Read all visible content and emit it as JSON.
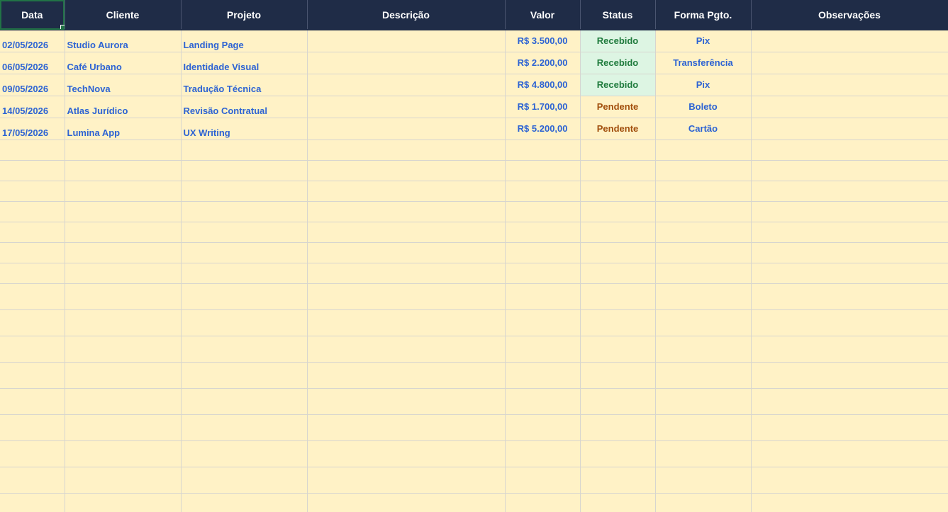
{
  "sheet": {
    "headers": {
      "data": "Data",
      "cliente": "Cliente",
      "projeto": "Projeto",
      "descricao": "Descrição",
      "valor": "Valor",
      "status": "Status",
      "forma": "Forma Pgto.",
      "observacoes": "Observações"
    },
    "rows": [
      {
        "data": "02/05/2026",
        "cliente": "Studio Aurora",
        "projeto": "Landing Page",
        "descricao": "",
        "valor": "R$ 3.500,00",
        "status": "Recebido",
        "forma": "Pix",
        "observacoes": ""
      },
      {
        "data": "06/05/2026",
        "cliente": "Café Urbano",
        "projeto": "Identidade Visual",
        "descricao": "",
        "valor": "R$ 2.200,00",
        "status": "Recebido",
        "forma": "Transferência",
        "observacoes": ""
      },
      {
        "data": "09/05/2026",
        "cliente": "TechNova",
        "projeto": "Tradução Técnica",
        "descricao": "",
        "valor": "R$ 4.800,00",
        "status": "Recebido",
        "forma": "Pix",
        "observacoes": ""
      },
      {
        "data": "14/05/2026",
        "cliente": "Atlas Jurídico",
        "projeto": "Revisão Contratual",
        "descricao": "",
        "valor": "R$ 1.700,00",
        "status": "Pendente",
        "forma": "Boleto",
        "observacoes": ""
      },
      {
        "data": "17/05/2026",
        "cliente": "Lumina App",
        "projeto": "UX Writing",
        "descricao": "",
        "valor": "R$ 5.200,00",
        "status": "Pendente",
        "forma": "Cartão",
        "observacoes": ""
      }
    ],
    "colors": {
      "header_bg": "#1f2c47",
      "header_text": "#ffffff",
      "cell_bg": "#fff2c6",
      "cell_text": "#2d63d3",
      "recebido_bg": "#ddf5e3",
      "recebido_text": "#1e7a3c",
      "pendente_text": "#a14e0c",
      "selection": "#217346"
    }
  }
}
